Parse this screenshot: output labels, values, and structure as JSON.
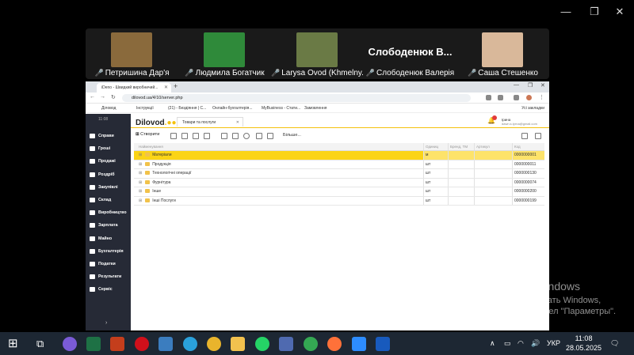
{
  "gallery": {
    "participants": [
      {
        "name": "Петришина Дар'я",
        "muted": true,
        "avatar_color": "#8a6a3c"
      },
      {
        "name": "Людмила Богатчик",
        "muted": true,
        "avatar_color": "#2f8a3a"
      },
      {
        "name": "Larysa Ovod (Khmelny...",
        "muted": true,
        "avatar_color": "#6a7a45"
      },
      {
        "name": "Слободенюк Валерія",
        "display_name": "Слободенюк В...",
        "muted": true
      },
      {
        "name": "Саша Стешенко",
        "muted": true,
        "avatar_color": "#d9b89a"
      }
    ]
  },
  "browser": {
    "tab_title": "iDeno - Швидкий виробничий...",
    "url": "dilovod.ua/4/10/server.php",
    "bookmarks": [
      "Діловод",
      "Інструкції",
      "(21) - Бездіяння | С...",
      "Онлайн-бухгалтерія...",
      "MyBusiness - Стати...",
      "Замовлення"
    ],
    "all_bookmarks": "Усі закладки"
  },
  "app": {
    "time": "11:08",
    "logo": "Dilovod",
    "doc_tab": "Товари та послуги",
    "user_name": "Ірина",
    "user_email": "dawn.s.tyrna@gmail.com",
    "create_label": "Створити",
    "more_label": "Більше...",
    "sidebar": [
      "Справи",
      "Гроші",
      "Продажі",
      "Роздріб",
      "Закупівлі",
      "Склад",
      "Виробництво",
      "Зарплата",
      "Майно",
      "Бухгалтерія",
      "Податки",
      "Результати",
      "Сервіс"
    ],
    "columns": [
      "Найменування",
      "Одиниц",
      "Бренд, ТМ",
      "Артикул",
      "Код"
    ],
    "rows": [
      {
        "name": "Матеріали",
        "unit": "м",
        "code": "0000000001",
        "selected": true
      },
      {
        "name": "Продукція",
        "unit": "шт",
        "code": "0000000011",
        "selected": false
      },
      {
        "name": "Технологічні операції",
        "unit": "шт",
        "code": "0000000130",
        "selected": false
      },
      {
        "name": "Фурнітура",
        "unit": "шт",
        "code": "0000000074",
        "selected": false
      },
      {
        "name": "Інше",
        "unit": "шт",
        "code": "0000000200",
        "selected": false
      },
      {
        "name": "Інші Послуги",
        "unit": "шт",
        "code": "0000000199",
        "selected": false
      }
    ]
  },
  "activation": {
    "title": "Активация Windows",
    "line1": "Чтобы активировать Windows,",
    "line2": "перейдите в раздел \"Параметры\"."
  },
  "taskbar": {
    "language": "УКР",
    "time": "11:08",
    "date": "28.05.2025"
  }
}
